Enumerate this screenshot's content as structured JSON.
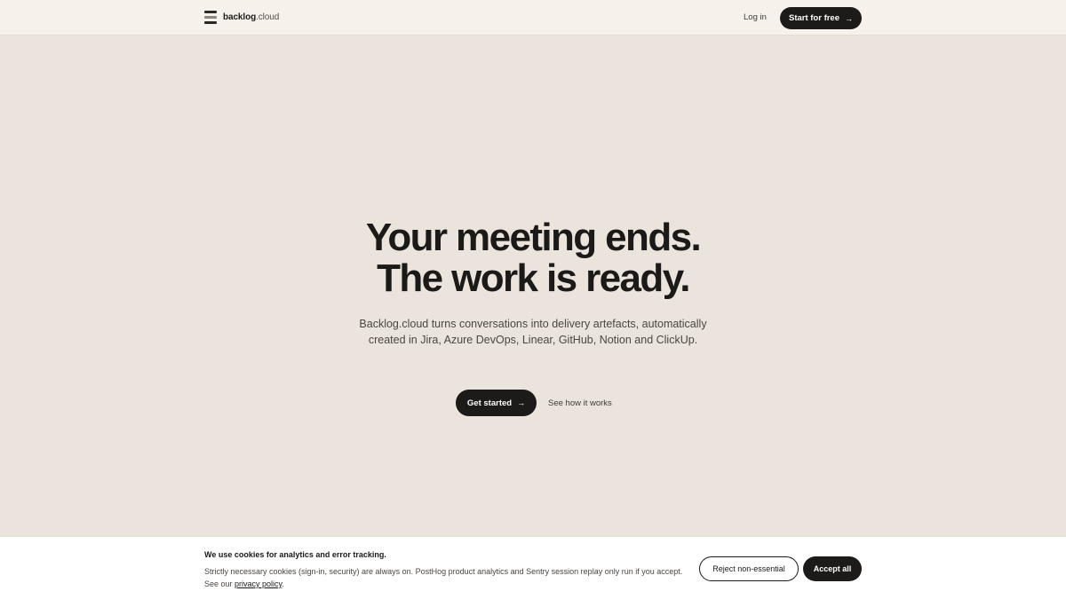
{
  "nav": {
    "brand_bold": "backlog",
    "brand_rest": ".cloud",
    "brand_icon": "stack-icon",
    "login_label": "Log in",
    "cta_label": "Start for free",
    "cta_icon": "arrow-right-icon"
  },
  "hero": {
    "headline_line1": "Your meeting ends.",
    "headline_line2": "The work is ready.",
    "subtitle": "Backlog.cloud turns conversations into delivery artefacts, automatically created in Jira, Azure DevOps, Linear, GitHub, Notion and ClickUp.",
    "primary_label": "Get started",
    "primary_icon": "arrow-right-icon",
    "secondary_label": "See how it works"
  },
  "cookie": {
    "title": "We use cookies for analytics and error tracking.",
    "body_text": "Strictly necessary cookies (sign-in, security) are always on. PostHog product analytics and Sentry session replay only run if you accept. See our ",
    "privacy_link": "privacy policy",
    "body_end": ".",
    "reject_label": "Reject non-essential",
    "accept_label": "Accept all"
  },
  "colors": {
    "hero_background": "#ebe4dd",
    "nav_background": "#f7f1ec",
    "button_dark": "#1c1b19",
    "text_primary": "#1b1a18"
  }
}
